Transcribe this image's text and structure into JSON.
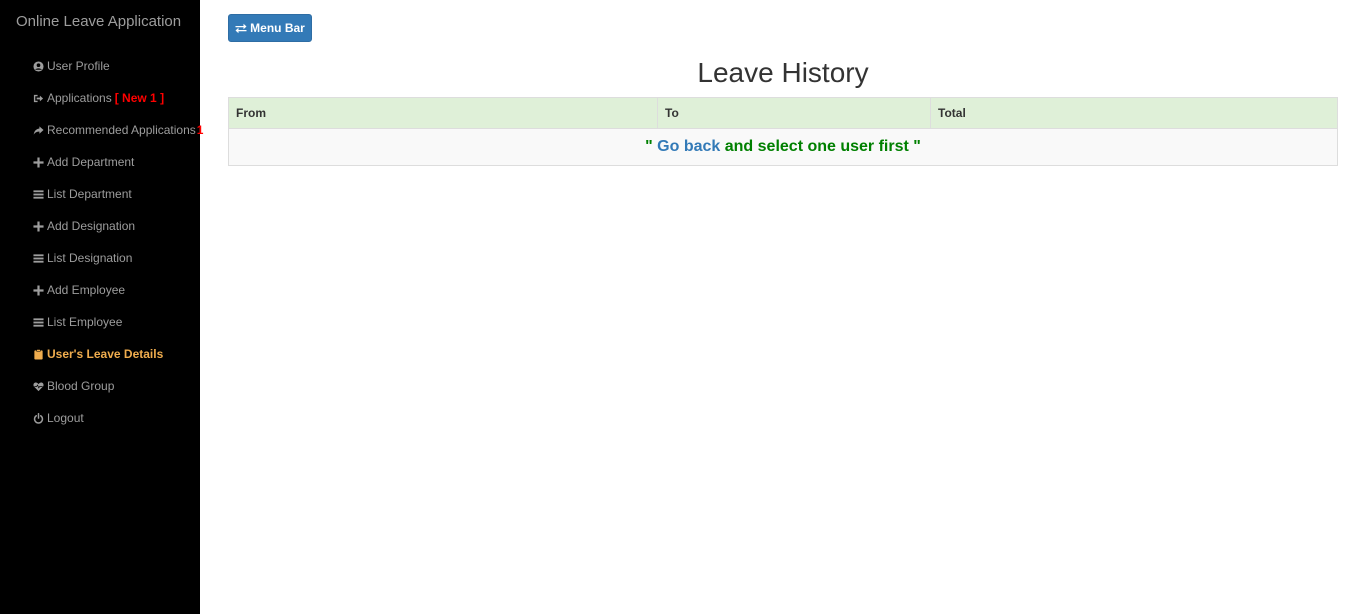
{
  "brand": "Online Leave Application",
  "sidebar": {
    "items": [
      {
        "label": "User Profile",
        "icon": "user-circle-icon"
      },
      {
        "label": "Applications",
        "badge": "[ New 1 ]",
        "icon": "sign-out-icon"
      },
      {
        "label": "Recommended Applications",
        "badge": "1",
        "icon": "share-arrow-icon"
      },
      {
        "label": "Add Department",
        "icon": "plus-icon"
      },
      {
        "label": "List Department",
        "icon": "list-icon"
      },
      {
        "label": "Add Designation",
        "icon": "plus-icon"
      },
      {
        "label": "List Designation",
        "icon": "list-icon"
      },
      {
        "label": "Add Employee",
        "icon": "plus-icon"
      },
      {
        "label": "List Employee",
        "icon": "list-icon"
      },
      {
        "label": "User's Leave Details",
        "icon": "clipboard-icon",
        "active": true
      },
      {
        "label": "Blood Group",
        "icon": "heartbeat-icon"
      },
      {
        "label": "Logout",
        "icon": "power-icon"
      }
    ]
  },
  "toolbar": {
    "menu_label": "Menu Bar",
    "menu_icon": "transfer-icon"
  },
  "page": {
    "title": "Leave History"
  },
  "table": {
    "columns": [
      "From",
      "To",
      "Total"
    ],
    "message": {
      "prefix": "\" ",
      "link": "Go back",
      "suffix": " and select one user first \""
    }
  },
  "colors": {
    "sidebar_bg": "#000000",
    "active": "#f0ad4e",
    "badge": "#ff0000",
    "primary": "#337ab7",
    "header_bg": "#dff0d8",
    "message": "#008000"
  }
}
